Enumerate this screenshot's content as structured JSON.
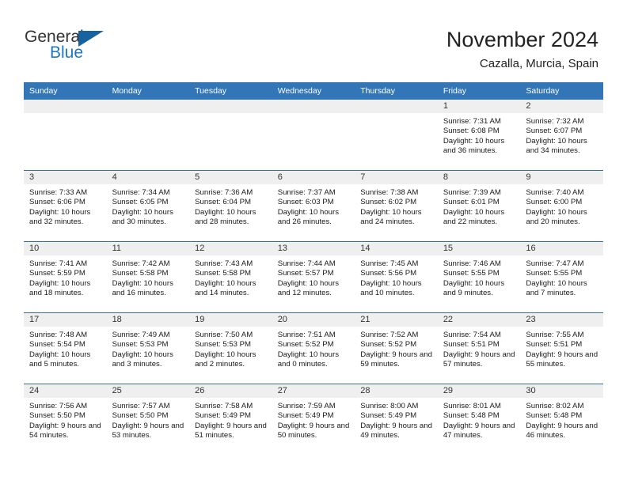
{
  "brand": {
    "word1": "General",
    "word2": "Blue",
    "logo_icon": "triangle-icon",
    "accent_color": "#1f77c4"
  },
  "header": {
    "title": "November 2024",
    "subtitle": "Cazalla, Murcia, Spain"
  },
  "calendar": {
    "header_bg": "#3376b8",
    "daynum_bg": "#efefef",
    "weekday_headers": [
      "Sunday",
      "Monday",
      "Tuesday",
      "Wednesday",
      "Thursday",
      "Friday",
      "Saturday"
    ],
    "weeks": [
      [
        {
          "day": "",
          "sunrise": "",
          "sunset": "",
          "daylight": "",
          "empty": true
        },
        {
          "day": "",
          "sunrise": "",
          "sunset": "",
          "daylight": "",
          "empty": true
        },
        {
          "day": "",
          "sunrise": "",
          "sunset": "",
          "daylight": "",
          "empty": true
        },
        {
          "day": "",
          "sunrise": "",
          "sunset": "",
          "daylight": "",
          "empty": true
        },
        {
          "day": "",
          "sunrise": "",
          "sunset": "",
          "daylight": "",
          "empty": true
        },
        {
          "day": "1",
          "sunrise": "Sunrise: 7:31 AM",
          "sunset": "Sunset: 6:08 PM",
          "daylight": "Daylight: 10 hours and 36 minutes."
        },
        {
          "day": "2",
          "sunrise": "Sunrise: 7:32 AM",
          "sunset": "Sunset: 6:07 PM",
          "daylight": "Daylight: 10 hours and 34 minutes."
        }
      ],
      [
        {
          "day": "3",
          "sunrise": "Sunrise: 7:33 AM",
          "sunset": "Sunset: 6:06 PM",
          "daylight": "Daylight: 10 hours and 32 minutes."
        },
        {
          "day": "4",
          "sunrise": "Sunrise: 7:34 AM",
          "sunset": "Sunset: 6:05 PM",
          "daylight": "Daylight: 10 hours and 30 minutes."
        },
        {
          "day": "5",
          "sunrise": "Sunrise: 7:36 AM",
          "sunset": "Sunset: 6:04 PM",
          "daylight": "Daylight: 10 hours and 28 minutes."
        },
        {
          "day": "6",
          "sunrise": "Sunrise: 7:37 AM",
          "sunset": "Sunset: 6:03 PM",
          "daylight": "Daylight: 10 hours and 26 minutes."
        },
        {
          "day": "7",
          "sunrise": "Sunrise: 7:38 AM",
          "sunset": "Sunset: 6:02 PM",
          "daylight": "Daylight: 10 hours and 24 minutes."
        },
        {
          "day": "8",
          "sunrise": "Sunrise: 7:39 AM",
          "sunset": "Sunset: 6:01 PM",
          "daylight": "Daylight: 10 hours and 22 minutes."
        },
        {
          "day": "9",
          "sunrise": "Sunrise: 7:40 AM",
          "sunset": "Sunset: 6:00 PM",
          "daylight": "Daylight: 10 hours and 20 minutes."
        }
      ],
      [
        {
          "day": "10",
          "sunrise": "Sunrise: 7:41 AM",
          "sunset": "Sunset: 5:59 PM",
          "daylight": "Daylight: 10 hours and 18 minutes."
        },
        {
          "day": "11",
          "sunrise": "Sunrise: 7:42 AM",
          "sunset": "Sunset: 5:58 PM",
          "daylight": "Daylight: 10 hours and 16 minutes."
        },
        {
          "day": "12",
          "sunrise": "Sunrise: 7:43 AM",
          "sunset": "Sunset: 5:58 PM",
          "daylight": "Daylight: 10 hours and 14 minutes."
        },
        {
          "day": "13",
          "sunrise": "Sunrise: 7:44 AM",
          "sunset": "Sunset: 5:57 PM",
          "daylight": "Daylight: 10 hours and 12 minutes."
        },
        {
          "day": "14",
          "sunrise": "Sunrise: 7:45 AM",
          "sunset": "Sunset: 5:56 PM",
          "daylight": "Daylight: 10 hours and 10 minutes."
        },
        {
          "day": "15",
          "sunrise": "Sunrise: 7:46 AM",
          "sunset": "Sunset: 5:55 PM",
          "daylight": "Daylight: 10 hours and 9 minutes."
        },
        {
          "day": "16",
          "sunrise": "Sunrise: 7:47 AM",
          "sunset": "Sunset: 5:55 PM",
          "daylight": "Daylight: 10 hours and 7 minutes."
        }
      ],
      [
        {
          "day": "17",
          "sunrise": "Sunrise: 7:48 AM",
          "sunset": "Sunset: 5:54 PM",
          "daylight": "Daylight: 10 hours and 5 minutes."
        },
        {
          "day": "18",
          "sunrise": "Sunrise: 7:49 AM",
          "sunset": "Sunset: 5:53 PM",
          "daylight": "Daylight: 10 hours and 3 minutes."
        },
        {
          "day": "19",
          "sunrise": "Sunrise: 7:50 AM",
          "sunset": "Sunset: 5:53 PM",
          "daylight": "Daylight: 10 hours and 2 minutes."
        },
        {
          "day": "20",
          "sunrise": "Sunrise: 7:51 AM",
          "sunset": "Sunset: 5:52 PM",
          "daylight": "Daylight: 10 hours and 0 minutes."
        },
        {
          "day": "21",
          "sunrise": "Sunrise: 7:52 AM",
          "sunset": "Sunset: 5:52 PM",
          "daylight": "Daylight: 9 hours and 59 minutes."
        },
        {
          "day": "22",
          "sunrise": "Sunrise: 7:54 AM",
          "sunset": "Sunset: 5:51 PM",
          "daylight": "Daylight: 9 hours and 57 minutes."
        },
        {
          "day": "23",
          "sunrise": "Sunrise: 7:55 AM",
          "sunset": "Sunset: 5:51 PM",
          "daylight": "Daylight: 9 hours and 55 minutes."
        }
      ],
      [
        {
          "day": "24",
          "sunrise": "Sunrise: 7:56 AM",
          "sunset": "Sunset: 5:50 PM",
          "daylight": "Daylight: 9 hours and 54 minutes."
        },
        {
          "day": "25",
          "sunrise": "Sunrise: 7:57 AM",
          "sunset": "Sunset: 5:50 PM",
          "daylight": "Daylight: 9 hours and 53 minutes."
        },
        {
          "day": "26",
          "sunrise": "Sunrise: 7:58 AM",
          "sunset": "Sunset: 5:49 PM",
          "daylight": "Daylight: 9 hours and 51 minutes."
        },
        {
          "day": "27",
          "sunrise": "Sunrise: 7:59 AM",
          "sunset": "Sunset: 5:49 PM",
          "daylight": "Daylight: 9 hours and 50 minutes."
        },
        {
          "day": "28",
          "sunrise": "Sunrise: 8:00 AM",
          "sunset": "Sunset: 5:49 PM",
          "daylight": "Daylight: 9 hours and 49 minutes."
        },
        {
          "day": "29",
          "sunrise": "Sunrise: 8:01 AM",
          "sunset": "Sunset: 5:48 PM",
          "daylight": "Daylight: 9 hours and 47 minutes."
        },
        {
          "day": "30",
          "sunrise": "Sunrise: 8:02 AM",
          "sunset": "Sunset: 5:48 PM",
          "daylight": "Daylight: 9 hours and 46 minutes."
        }
      ]
    ]
  }
}
